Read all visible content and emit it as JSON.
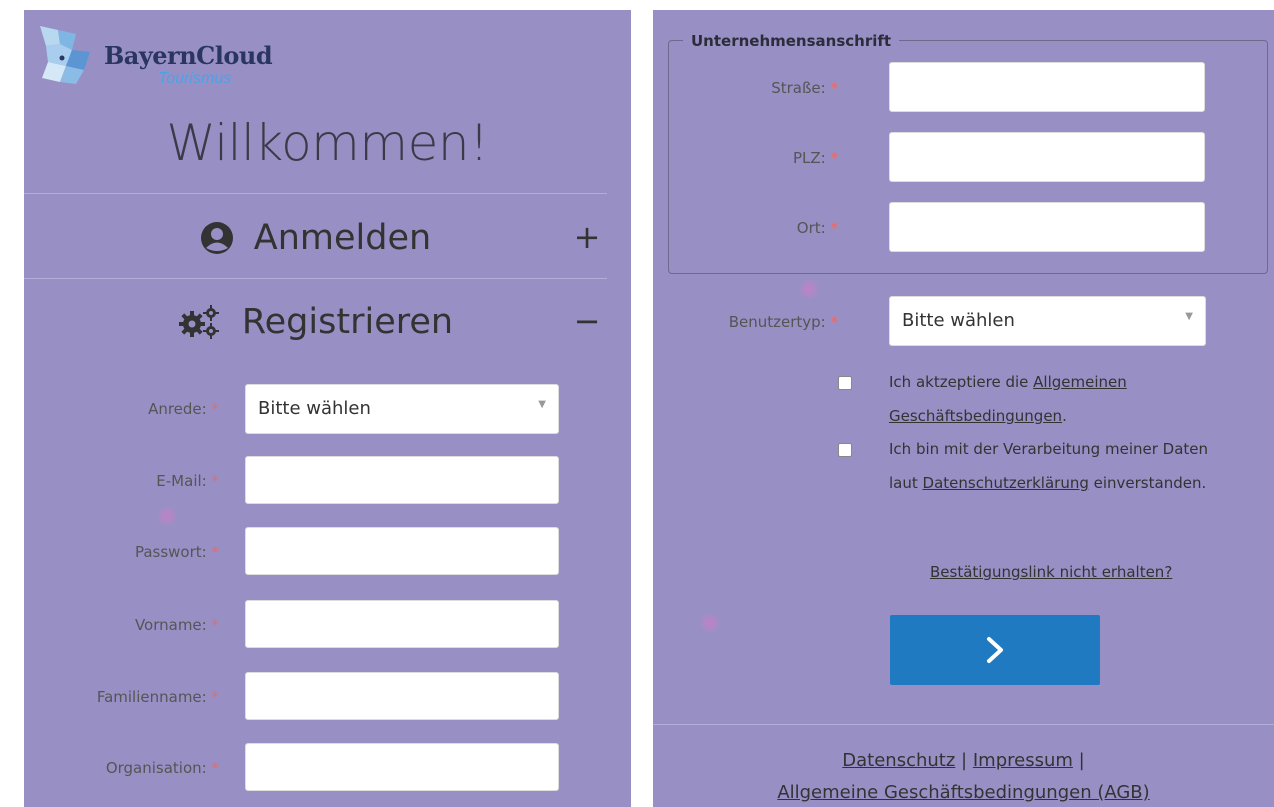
{
  "brand": {
    "name": "BayernCloud",
    "sub": "Tourismus"
  },
  "welcome": "Willkommen!",
  "sections": {
    "login": {
      "title": "Anmelden",
      "toggle": "+",
      "icon": "user-circle-icon"
    },
    "register": {
      "title": "Registrieren",
      "toggle": "−",
      "icon": "gears-icon"
    }
  },
  "form": {
    "required_mark": "*",
    "fields": [
      {
        "label": "Anrede:",
        "type": "select",
        "value": "Bitte wählen"
      },
      {
        "label": "E-Mail:",
        "type": "text",
        "value": ""
      },
      {
        "label": "Passwort:",
        "type": "password",
        "value": ""
      },
      {
        "label": "Vorname:",
        "type": "text",
        "value": ""
      },
      {
        "label": "Familienname:",
        "type": "text",
        "value": ""
      },
      {
        "label": "Organisation:",
        "type": "text",
        "value": ""
      }
    ],
    "address": {
      "legend": "Unternehmensanschrift",
      "fields": [
        {
          "label": "Straße:",
          "value": ""
        },
        {
          "label": "PLZ:",
          "value": ""
        },
        {
          "label": "Ort:",
          "value": ""
        }
      ]
    },
    "user_type": {
      "label": "Benutzertyp:",
      "value": "Bitte wählen"
    },
    "consents": [
      {
        "text_before": "Ich aktzeptiere die ",
        "link": "Allgemeinen Geschäftsbedingungen",
        "text_after": ".",
        "checked": false
      },
      {
        "text_before": "Ich bin mit der Verarbeitung meiner Daten laut ",
        "link": "Datenschutzerklärung",
        "text_after": " einverstanden.",
        "checked": false
      }
    ],
    "resend_link": "Bestätigungslink nicht erhalten?",
    "submit_icon": "chevron-right-icon"
  },
  "footer": {
    "privacy": "Datenschutz",
    "sep": "|",
    "imprint": "Impressum",
    "terms": "Allgemeine Geschäftsbedingungen (AGB)"
  },
  "colors": {
    "panel_bg": "#9890c5",
    "button": "#1f7ac1",
    "required": "#e56b6b",
    "brand_text": "#2a3560",
    "brand_sub": "#4aa3e8"
  }
}
